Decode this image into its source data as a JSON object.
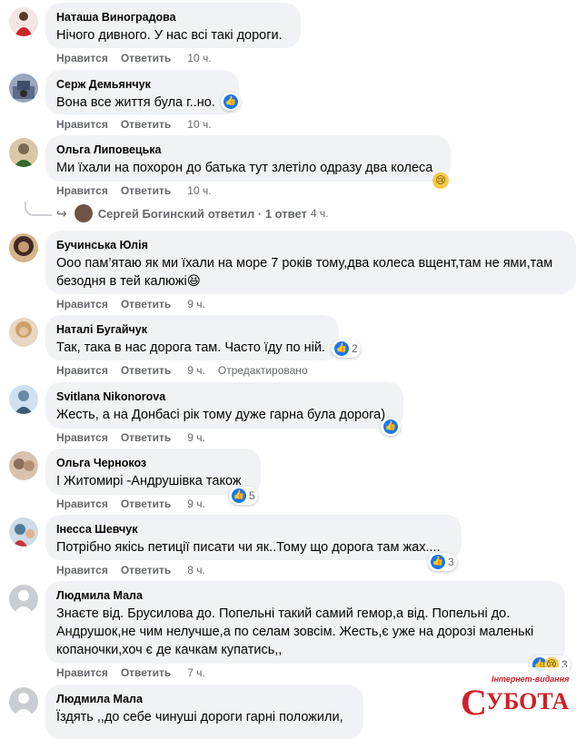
{
  "ui": {
    "like_label": "Нравится",
    "reply_label": "Ответить"
  },
  "comments": [
    {
      "name": "Наташа Виноградова",
      "text": "Нічого дивного. У нас всі такі дороги.",
      "time": "10 ч.",
      "avatar_color": "#c62828"
    },
    {
      "name": "Серж Демьянчук",
      "text": "Вона все життя була г..но.",
      "time": "10 ч.",
      "avatar_color": "#5b6b8a",
      "reactions": "1"
    },
    {
      "name": "Ольга Липовецька",
      "text": "Ми їхали на похорон до батька тут злетіло одразу два колеса",
      "time": "10 ч.",
      "avatar_color": "#7a6a4f"
    },
    {
      "name": "Бучинська Юлія",
      "text": "Ооо пам’ятаю як ми їхали на море 7 років тому,два колеса вщент,там не ями,там безодня в тей калюжі😆",
      "time": "9 ч.",
      "avatar_color": "#3e2a22"
    },
    {
      "name": "Наталі Бугайчук",
      "text": "Так, така в нас дорога там. Часто їду по ній.",
      "time": "9 ч.",
      "edited": "Отредактировано",
      "avatar_color": "#b08a6a",
      "reactions": "2"
    },
    {
      "name": "Svitlana Nikonorova",
      "text": "Жесть, а на Донбасі рік тому дуже гарна була дорога)",
      "time": "9 ч.",
      "avatar_color": "#6a88a8"
    },
    {
      "name": "Ольга Чернокоз",
      "text": "І Житомирі -Андрушівка також",
      "time": "9 ч.",
      "avatar_color": "#8c6e5a",
      "reactions": "5"
    },
    {
      "name": "Інесса Шевчук",
      "text": "Потрібно якісь петиції писати чи як..Тому що дорога там жах....",
      "time": "8 ч.",
      "avatar_color": "#4f7a9a",
      "reactions": "3"
    },
    {
      "name": "Людмила Мала",
      "text": "Знаєте від. Брусилова до. Попельні такий самий гемор,а від. Попельні до. Андрушок,не чим нелучше,а по селам зовсім. Жесть,є уже на дорозі маленькі копаночки,хоч є де качкам купатись,,",
      "time": "7 ч.",
      "avatar_color": "#c9ccd1",
      "reactions": "3"
    },
    {
      "name": "Людмила Мала",
      "text": "Їздять ,,до себе чинуші дороги гарні положили,",
      "avatar_color": "#c9ccd1"
    }
  ],
  "reply_summary": {
    "author": "Сергей Богинский",
    "label": "ответил · 1 ответ",
    "time": "4 ч."
  },
  "watermark": {
    "top": "Інтернет-видання",
    "main": "СУБОТА",
    "color": "#d0202a"
  }
}
